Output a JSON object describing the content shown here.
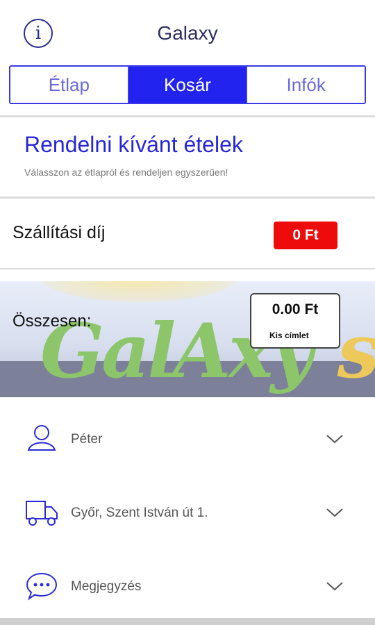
{
  "header": {
    "title": "Galaxy",
    "info_icon": "i"
  },
  "tabs": [
    {
      "label": "Étlap",
      "active": false
    },
    {
      "label": "Kosár",
      "active": true
    },
    {
      "label": "Infók",
      "active": false
    }
  ],
  "order": {
    "title": "Rendelni kívánt ételek",
    "subtitle": "Válasszon az étlapról és rendeljen egyszerűen!"
  },
  "delivery_fee": {
    "label": "Szállítási díj",
    "value": "0 Ft",
    "color": "#ee0b0b"
  },
  "total": {
    "label": "Összesen:",
    "value": "0.00 Ft",
    "note": "Kis címlet",
    "banner_logo": {
      "part1": "GalAxy",
      "part2": "’s"
    }
  },
  "details": [
    {
      "icon": "person-icon",
      "text": "Péter"
    },
    {
      "icon": "delivery-truck-icon",
      "text": "Győr, Szent István út 1."
    },
    {
      "icon": "chat-bubble-icon",
      "text": "Megjegyzés"
    }
  ],
  "colors": {
    "accent": "#2323f0",
    "accent_light": "#6a6ad8",
    "fee_badge": "#ee0b0b"
  }
}
